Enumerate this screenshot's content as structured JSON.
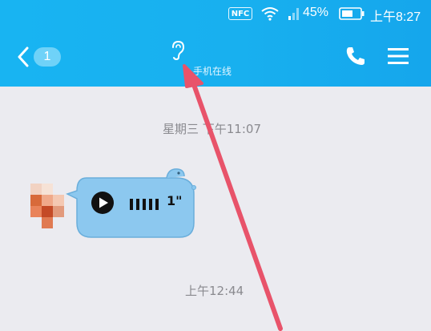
{
  "status_bar": {
    "nfc_label": "NFC",
    "battery_percent": "45%",
    "time": "上午8:27"
  },
  "nav": {
    "unread_count": "1",
    "contact_status": "手机在线",
    "icons": {
      "back": "chevron-left-icon",
      "mode": "earpiece-icon",
      "call": "phone-icon",
      "menu": "hamburger-menu-icon"
    }
  },
  "chat": {
    "timestamps": [
      "星期三 下午11:07",
      "上午12:44"
    ],
    "messages": [
      {
        "type": "voice",
        "duration": "1\"",
        "bubble_color": "#8cc8ef"
      }
    ]
  },
  "colors": {
    "header": "#18b0ef",
    "chat_background": "#ebebf0",
    "annotation_arrow": "#e8536a"
  }
}
